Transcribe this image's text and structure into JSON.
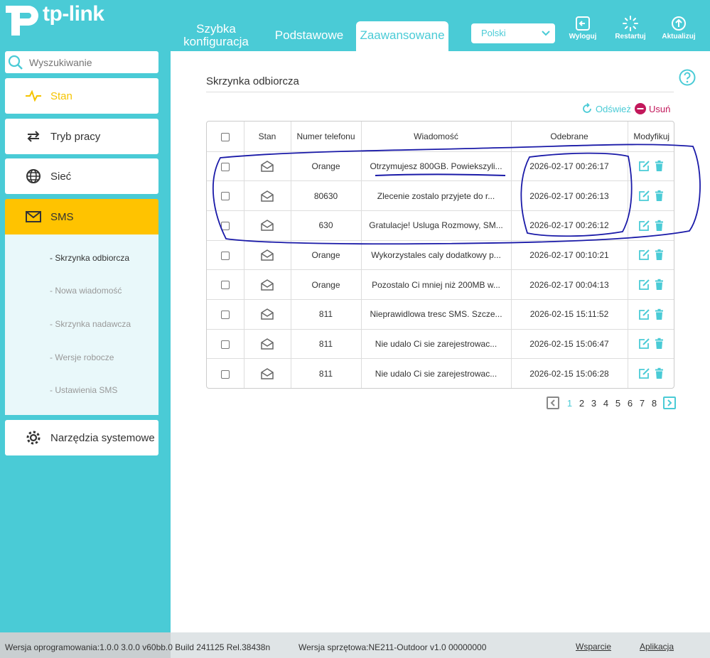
{
  "brand": {
    "name": "tp-link"
  },
  "header": {
    "tabs": [
      {
        "label_line1": "Szybka",
        "label_line2": "konfiguracja"
      },
      {
        "label": "Podstawowe"
      },
      {
        "label": "Zaawansowane"
      }
    ],
    "language": {
      "selected": "Polski"
    },
    "buttons": {
      "logout": "Wyloguj",
      "reboot": "Restartuj",
      "update": "Aktualizuj"
    }
  },
  "sidebar": {
    "search_placeholder": "Wyszukiwanie",
    "items": [
      {
        "label": "Stan",
        "icon": "pulse-icon"
      },
      {
        "label": "Tryb pracy",
        "icon": "switch-arrows-icon"
      },
      {
        "label": "Sieć",
        "icon": "globe-icon"
      },
      {
        "label": "SMS",
        "icon": "envelope-icon"
      },
      {
        "label": "Narzędzia systemowe",
        "icon": "gear-icon"
      }
    ],
    "sms_submenu": [
      "- Skrzynka odbiorcza",
      "- Nowa wiadomość",
      "- Skrzynka nadawcza",
      "- Wersje robocze",
      "- Ustawienia SMS"
    ]
  },
  "main": {
    "title": "Skrzynka odbiorcza",
    "actions": {
      "refresh": "Odśwież",
      "delete": "Usuń"
    },
    "table": {
      "columns": [
        "Stan",
        "Numer telefonu",
        "Wiadomość",
        "Odebrane",
        "Modyfikuj"
      ],
      "rows": [
        {
          "number": "Orange",
          "message": "Otrzymujesz 800GB. Powiekszyli...",
          "received": "2026-02-17 00:26:17"
        },
        {
          "number": "80630",
          "message": "Zlecenie zostalo przyjete do r...",
          "received": "2026-02-17 00:26:13"
        },
        {
          "number": "630",
          "message": "Gratulacje! Usluga Rozmowy, SM...",
          "received": "2026-02-17 00:26:12"
        },
        {
          "number": "Orange",
          "message": "Wykorzystales caly dodatkowy p...",
          "received": "2026-02-17 00:10:21"
        },
        {
          "number": "Orange",
          "message": "Pozostalo Ci mniej niż 200MB w...",
          "received": "2026-02-17 00:04:13"
        },
        {
          "number": "811",
          "message": "Nieprawidlowa tresc SMS. Szcze...",
          "received": "2026-02-15 15:11:52"
        },
        {
          "number": "811",
          "message": "Nie udalo Ci sie zarejestrowac...",
          "received": "2026-02-15 15:06:47"
        },
        {
          "number": "811",
          "message": "Nie udalo Ci sie zarejestrowac...",
          "received": "2026-02-15 15:06:28"
        }
      ]
    },
    "pagination": {
      "pages": [
        "1",
        "2",
        "3",
        "4",
        "5",
        "6",
        "7",
        "8"
      ],
      "current": "1"
    }
  },
  "footer": {
    "firmware": "Wersja oprogramowania:1.0.0 3.0.0 v60bb.0 Build 241125 Rel.38438n",
    "hardware": "Wersja sprzętowa:NE211-Outdoor v1.0 00000000",
    "support": "Wsparcie",
    "app": "Aplikacja"
  },
  "colors": {
    "accent": "#4acbd6",
    "active_menu": "#ffc300",
    "delete": "#c2185b",
    "annotation": "#1a1aa8"
  }
}
